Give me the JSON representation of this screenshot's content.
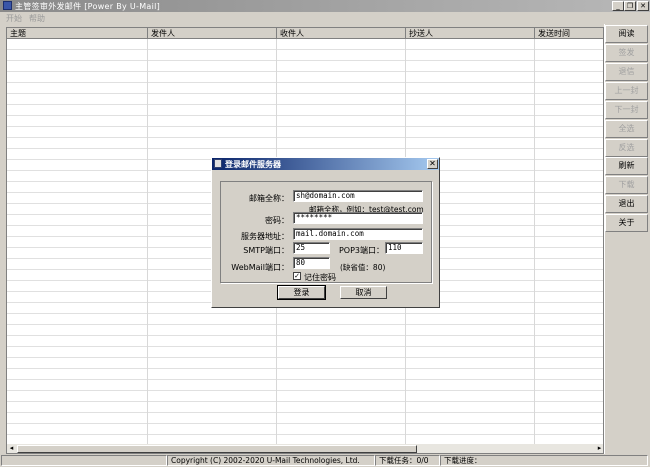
{
  "window": {
    "title": "主管签审外发邮件 [Power By U-Mail]",
    "controls": [
      "_",
      "❐",
      "✕"
    ]
  },
  "menu": [
    "开始",
    "帮助"
  ],
  "list": {
    "columns": [
      "主题",
      "发件人",
      "收件人",
      "抄送人",
      "发送时间"
    ]
  },
  "side_buttons": [
    {
      "label": "阅读",
      "enabled": true
    },
    {
      "label": "签发",
      "enabled": false
    },
    {
      "label": "退信",
      "enabled": false
    },
    {
      "label": "上一封",
      "enabled": false
    },
    {
      "label": "下一封",
      "enabled": false
    },
    {
      "label": "全选",
      "enabled": false
    },
    {
      "label": "反选",
      "enabled": false
    },
    {
      "label": "刷新",
      "enabled": true
    },
    {
      "label": "下载",
      "enabled": false
    },
    {
      "label": "退出",
      "enabled": true
    },
    {
      "label": "关于",
      "enabled": true
    }
  ],
  "status": {
    "copyright": "Copyright (C) 2002-2020 U-Mail Technologies, Ltd.",
    "download_tasks": "下载任务：0/0",
    "download_progress": "下载进度："
  },
  "dialog": {
    "title": "登录邮件服务器",
    "close": "✕",
    "email_label": "邮箱全称：",
    "email_value": "sh@domain.com",
    "email_hint": "邮箱全称，例如：test@test.com",
    "password_label": "密码：",
    "password_value": "********",
    "server_label": "服务器地址：",
    "server_value": "mail.domain.com",
    "smtp_label": "SMTP端口：",
    "smtp_value": "25",
    "pop3_label": "POP3端口：",
    "pop3_value": "110",
    "webmail_label": "WebMail端口：",
    "webmail_value": "80",
    "webmail_hint": "(缺省值：80)",
    "remember_label": "记住密码",
    "remember_checked": true,
    "login_label": "登录",
    "cancel_label": "取消"
  }
}
